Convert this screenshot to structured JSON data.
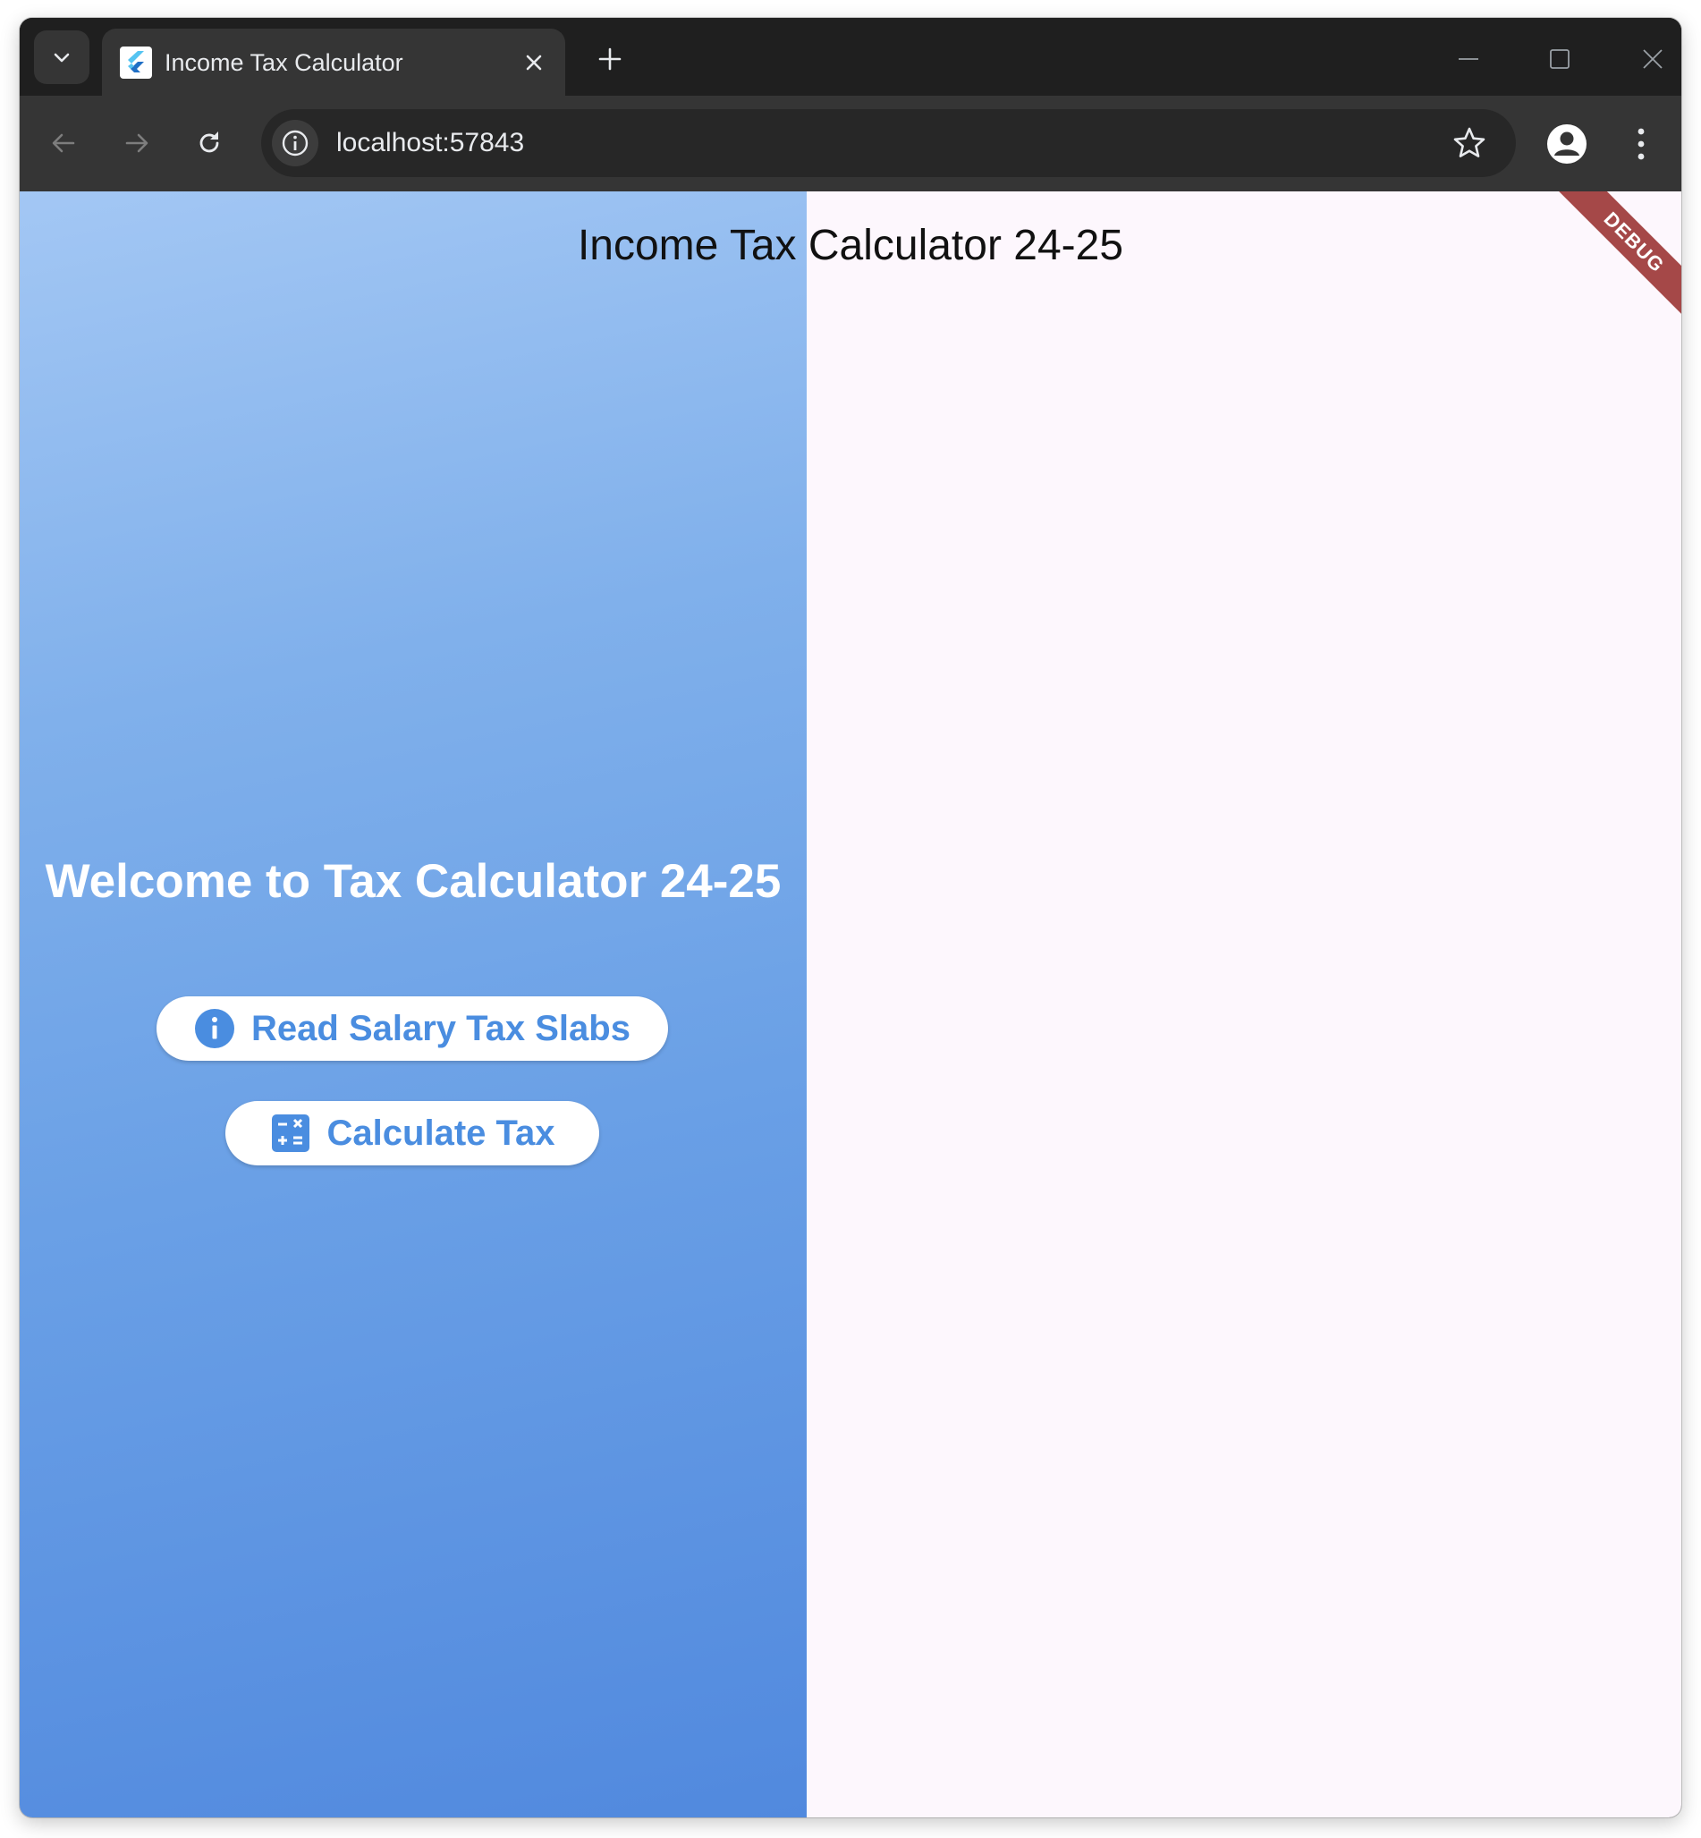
{
  "browser": {
    "tab": {
      "title": "Income Tax Calculator"
    },
    "address_bar": {
      "url": "localhost:57843"
    }
  },
  "app": {
    "title": "Income Tax Calculator 24-25",
    "welcome": "Welcome to Tax Calculator 24-25",
    "buttons": {
      "read_slabs": "Read Salary Tax Slabs",
      "calculate": "Calculate Tax"
    },
    "debug_banner": "DEBUG"
  },
  "colors": {
    "accent": "#4a8de0",
    "gradient_top": "#a3c7f4",
    "gradient_bottom": "#5189de",
    "content_background": "#fdf7fd",
    "debug_ribbon": "#a54848"
  },
  "icons": {
    "tab_search": "chevron-down-icon",
    "favicon": "flutter-logo-icon",
    "tab_close": "close-icon",
    "new_tab": "plus-icon",
    "back": "arrow-left-icon",
    "forward": "arrow-right-icon",
    "reload": "reload-icon",
    "site_info": "info-icon",
    "bookmark": "star-icon",
    "profile": "person-icon",
    "menu": "more-vertical-icon",
    "read_slabs": "info-icon",
    "calculate": "calculator-icon"
  }
}
